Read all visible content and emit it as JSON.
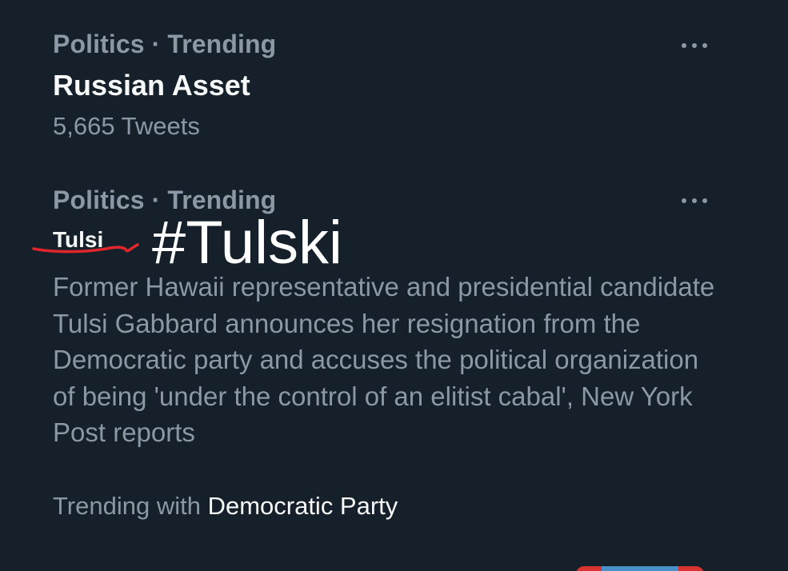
{
  "trends": [
    {
      "context": "Politics · Trending",
      "title": "Russian Asset",
      "tweet_count": "5,665 Tweets"
    },
    {
      "context": "Politics · Trending",
      "original_title": "Tulsi",
      "annotated_title": "#Tulski",
      "summary": "Former Hawaii representative and presidential candidate Tulsi Gabbard announces her resignation from the Democratic party and accuses the political organization of being 'under the control of an elitist cabal', New York Post reports",
      "trending_with_label": "Trending with",
      "trending_with_topic": "Democratic Party"
    }
  ],
  "icons": {
    "more": "more-horizontal-icon"
  },
  "colors": {
    "background": "#15202b",
    "primary_text": "#f7f9f9",
    "secondary_text": "#8b98a5",
    "annotation_strike": "#e0262b"
  }
}
